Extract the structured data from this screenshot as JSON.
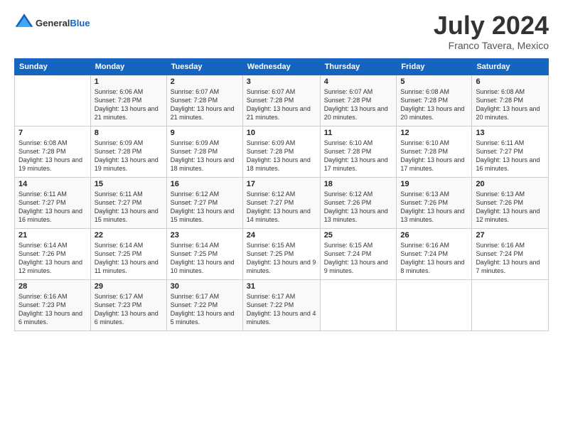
{
  "header": {
    "logo_general": "General",
    "logo_blue": "Blue",
    "month_year": "July 2024",
    "location": "Franco Tavera, Mexico"
  },
  "columns": [
    "Sunday",
    "Monday",
    "Tuesday",
    "Wednesday",
    "Thursday",
    "Friday",
    "Saturday"
  ],
  "weeks": [
    [
      {
        "day": "",
        "sunrise": "",
        "sunset": "",
        "daylight": ""
      },
      {
        "day": "1",
        "sunrise": "6:06 AM",
        "sunset": "7:28 PM",
        "daylight": "13 hours and 21 minutes."
      },
      {
        "day": "2",
        "sunrise": "6:07 AM",
        "sunset": "7:28 PM",
        "daylight": "13 hours and 21 minutes."
      },
      {
        "day": "3",
        "sunrise": "6:07 AM",
        "sunset": "7:28 PM",
        "daylight": "13 hours and 21 minutes."
      },
      {
        "day": "4",
        "sunrise": "6:07 AM",
        "sunset": "7:28 PM",
        "daylight": "13 hours and 20 minutes."
      },
      {
        "day": "5",
        "sunrise": "6:08 AM",
        "sunset": "7:28 PM",
        "daylight": "13 hours and 20 minutes."
      },
      {
        "day": "6",
        "sunrise": "6:08 AM",
        "sunset": "7:28 PM",
        "daylight": "13 hours and 20 minutes."
      }
    ],
    [
      {
        "day": "7",
        "sunrise": "6:08 AM",
        "sunset": "7:28 PM",
        "daylight": "13 hours and 19 minutes."
      },
      {
        "day": "8",
        "sunrise": "6:09 AM",
        "sunset": "7:28 PM",
        "daylight": "13 hours and 19 minutes."
      },
      {
        "day": "9",
        "sunrise": "6:09 AM",
        "sunset": "7:28 PM",
        "daylight": "13 hours and 18 minutes."
      },
      {
        "day": "10",
        "sunrise": "6:09 AM",
        "sunset": "7:28 PM",
        "daylight": "13 hours and 18 minutes."
      },
      {
        "day": "11",
        "sunrise": "6:10 AM",
        "sunset": "7:28 PM",
        "daylight": "13 hours and 17 minutes."
      },
      {
        "day": "12",
        "sunrise": "6:10 AM",
        "sunset": "7:28 PM",
        "daylight": "13 hours and 17 minutes."
      },
      {
        "day": "13",
        "sunrise": "6:11 AM",
        "sunset": "7:27 PM",
        "daylight": "13 hours and 16 minutes."
      }
    ],
    [
      {
        "day": "14",
        "sunrise": "6:11 AM",
        "sunset": "7:27 PM",
        "daylight": "13 hours and 16 minutes."
      },
      {
        "day": "15",
        "sunrise": "6:11 AM",
        "sunset": "7:27 PM",
        "daylight": "13 hours and 15 minutes."
      },
      {
        "day": "16",
        "sunrise": "6:12 AM",
        "sunset": "7:27 PM",
        "daylight": "13 hours and 15 minutes."
      },
      {
        "day": "17",
        "sunrise": "6:12 AM",
        "sunset": "7:27 PM",
        "daylight": "13 hours and 14 minutes."
      },
      {
        "day": "18",
        "sunrise": "6:12 AM",
        "sunset": "7:26 PM",
        "daylight": "13 hours and 13 minutes."
      },
      {
        "day": "19",
        "sunrise": "6:13 AM",
        "sunset": "7:26 PM",
        "daylight": "13 hours and 13 minutes."
      },
      {
        "day": "20",
        "sunrise": "6:13 AM",
        "sunset": "7:26 PM",
        "daylight": "13 hours and 12 minutes."
      }
    ],
    [
      {
        "day": "21",
        "sunrise": "6:14 AM",
        "sunset": "7:26 PM",
        "daylight": "13 hours and 12 minutes."
      },
      {
        "day": "22",
        "sunrise": "6:14 AM",
        "sunset": "7:25 PM",
        "daylight": "13 hours and 11 minutes."
      },
      {
        "day": "23",
        "sunrise": "6:14 AM",
        "sunset": "7:25 PM",
        "daylight": "13 hours and 10 minutes."
      },
      {
        "day": "24",
        "sunrise": "6:15 AM",
        "sunset": "7:25 PM",
        "daylight": "13 hours and 9 minutes."
      },
      {
        "day": "25",
        "sunrise": "6:15 AM",
        "sunset": "7:24 PM",
        "daylight": "13 hours and 9 minutes."
      },
      {
        "day": "26",
        "sunrise": "6:16 AM",
        "sunset": "7:24 PM",
        "daylight": "13 hours and 8 minutes."
      },
      {
        "day": "27",
        "sunrise": "6:16 AM",
        "sunset": "7:24 PM",
        "daylight": "13 hours and 7 minutes."
      }
    ],
    [
      {
        "day": "28",
        "sunrise": "6:16 AM",
        "sunset": "7:23 PM",
        "daylight": "13 hours and 6 minutes."
      },
      {
        "day": "29",
        "sunrise": "6:17 AM",
        "sunset": "7:23 PM",
        "daylight": "13 hours and 6 minutes."
      },
      {
        "day": "30",
        "sunrise": "6:17 AM",
        "sunset": "7:22 PM",
        "daylight": "13 hours and 5 minutes."
      },
      {
        "day": "31",
        "sunrise": "6:17 AM",
        "sunset": "7:22 PM",
        "daylight": "13 hours and 4 minutes."
      },
      {
        "day": "",
        "sunrise": "",
        "sunset": "",
        "daylight": ""
      },
      {
        "day": "",
        "sunrise": "",
        "sunset": "",
        "daylight": ""
      },
      {
        "day": "",
        "sunrise": "",
        "sunset": "",
        "daylight": ""
      }
    ]
  ]
}
